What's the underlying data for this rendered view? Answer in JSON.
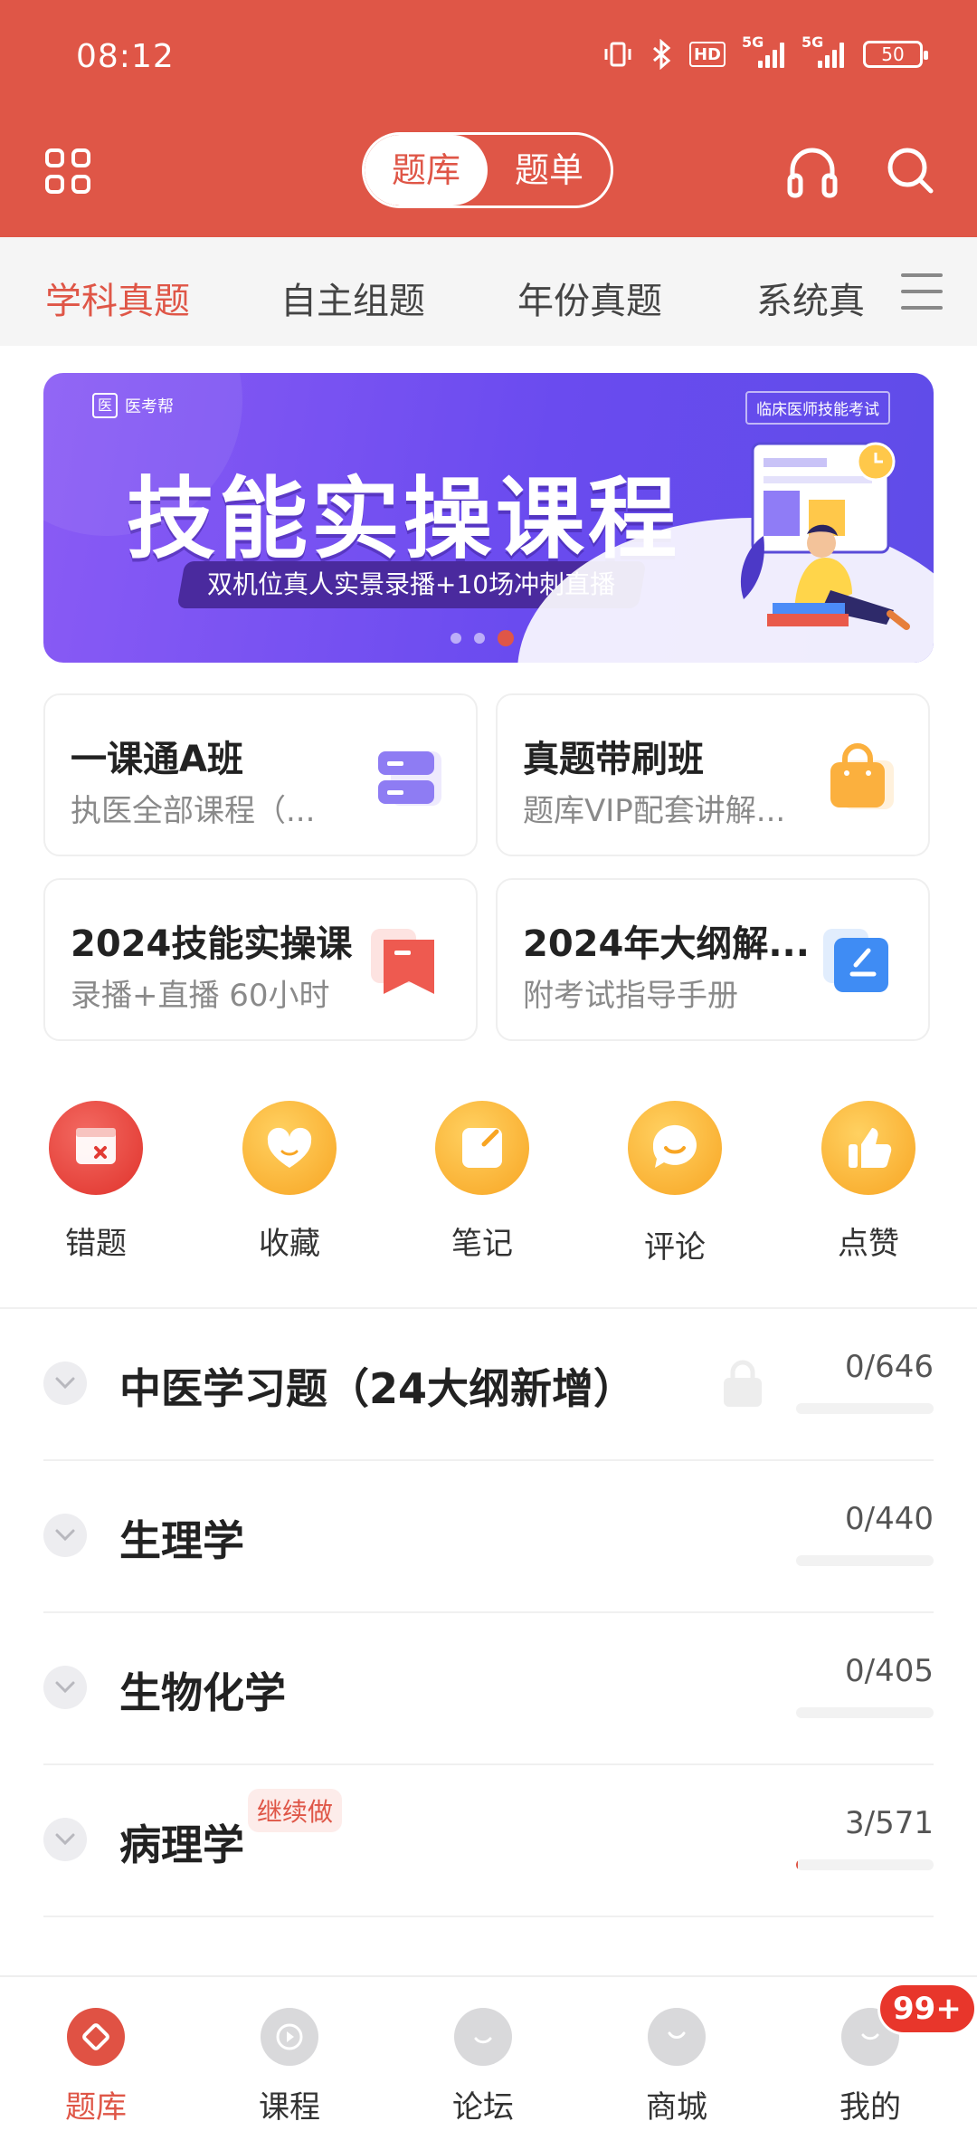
{
  "status_bar": {
    "time": "08:12",
    "hd_label": "HD",
    "sig1_label": "5G",
    "sig2_label": "5G",
    "battery": "50"
  },
  "top_nav": {
    "segment": [
      "题库",
      "题单"
    ],
    "icons": [
      "grid-icon",
      "headphones-icon",
      "search-icon"
    ]
  },
  "subject_tabs": {
    "items": [
      "学科真题",
      "自主组题",
      "年份真题",
      "系统真"
    ],
    "active": "学科真题"
  },
  "banner": {
    "logo": "医考帮",
    "tag": "临床医师技能考试",
    "title": "技能实操课程",
    "subtitle": "双机位真人实景录播+10场冲刺直播",
    "dots": 3,
    "active_dot": 3
  },
  "course_cards": [
    {
      "title": "一课通A班",
      "subtitle": "执医全部课程（...",
      "icon": "server-icon"
    },
    {
      "title": "真题带刷班",
      "subtitle": "题库VIP配套讲解...",
      "icon": "shopping-bag-icon"
    },
    {
      "title": "2024技能实操课",
      "subtitle": "录播+直播 60小时",
      "icon": "bookmark-icon"
    },
    {
      "title": "2024年大纲解...",
      "subtitle": "附考试指导手册",
      "icon": "edit-icon"
    }
  ],
  "quick_actions": [
    {
      "label": "错题",
      "icon": "wrong-question-icon",
      "color": "#E23A33"
    },
    {
      "label": "收藏",
      "icon": "heart-icon",
      "color": "#F8A523"
    },
    {
      "label": "笔记",
      "icon": "note-icon",
      "color": "#F8A523"
    },
    {
      "label": "评论",
      "icon": "comment-icon",
      "color": "#F8A523"
    },
    {
      "label": "点赞",
      "icon": "thumbs-up-icon",
      "color": "#F8A523"
    }
  ],
  "subjects": [
    {
      "name": "中医学习题（24大纲新增）",
      "progress": "0/646",
      "done": 0,
      "total": 646,
      "locked": true
    },
    {
      "name": "生理学",
      "progress": "0/440",
      "done": 0,
      "total": 440
    },
    {
      "name": "生物化学",
      "progress": "0/405",
      "done": 0,
      "total": 405
    },
    {
      "name": "病理学",
      "progress": "3/571",
      "done": 3,
      "total": 571,
      "badge": "继续做"
    }
  ],
  "bottom_nav": {
    "items": [
      "题库",
      "课程",
      "论坛",
      "商城",
      "我的"
    ],
    "active": "题库",
    "badge": "99+"
  },
  "colors": {
    "accent": "#DF5647",
    "banner": "#6A4BEF"
  }
}
